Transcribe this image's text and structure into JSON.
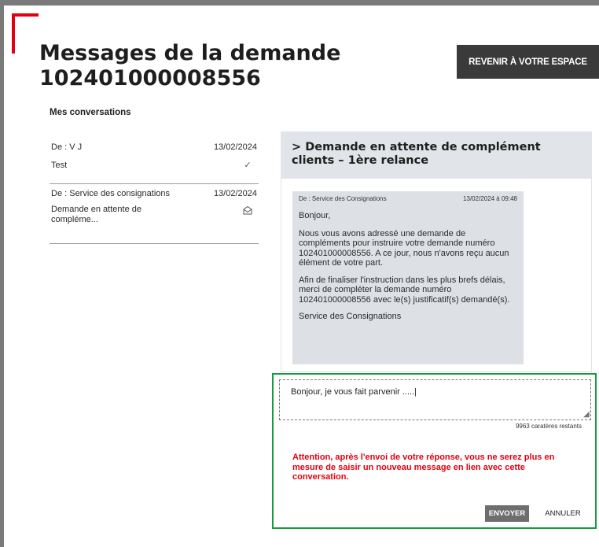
{
  "page": {
    "title": "Messages de la demande 102401000008556",
    "back_button": "REVENIR À VOTRE ESPACE"
  },
  "conversations": {
    "heading": "Mes conversations",
    "items": [
      {
        "from": "De : V J",
        "date": "13/02/2024",
        "subject": "Test",
        "status_icon": "check-icon",
        "status_glyph": "✓"
      },
      {
        "from": "De : Service des consignations",
        "date": "13/02/2024",
        "subject": "Demande en attente de compléme...",
        "status_icon": "envelope-open-icon",
        "status_glyph": "✉"
      }
    ]
  },
  "detail": {
    "title_chevron": ">",
    "title": "Demande en attente de complément clients – 1ère relance",
    "message": {
      "from": "De : Service des Consignations",
      "date": "13/02/2024 à 09:48",
      "paragraphs": [
        "Bonjour,",
        "Nous vous avons adressé une demande de compléments pour instruire votre demande numéro 102401000008556. A ce jour, nous n'avons reçu aucun élément de votre part.",
        "Afin de finaliser l'instruction dans les plus brefs délais, merci de compléter la demande numéro 102401000008556 avec le(s) justificatif(s) demandé(s).",
        "Service des Consignations"
      ]
    }
  },
  "reply": {
    "value": "Bonjour, je vous fait parvenir .....|",
    "chars_remaining": "9963",
    "chars_remaining_label": "caratères restants",
    "warning": "Attention, après l'envoi de votre réponse, vous ne serez plus en mesure de saisir un nouveau message en lien avec cette conversation.",
    "send_label": "ENVOYER",
    "cancel_label": "ANNULER"
  },
  "colors": {
    "brand_red": "#e1000f",
    "highlight_green": "#1a9a3e",
    "dark_button": "#3a3a3a",
    "panel_gray": "#e1e4e8"
  }
}
